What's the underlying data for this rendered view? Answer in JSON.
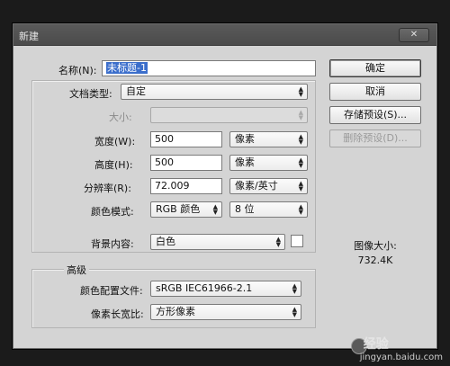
{
  "window": {
    "title": "新建",
    "close_icon": "✕"
  },
  "form": {
    "name_label": "名称(N):",
    "name_value": "未标题-1",
    "doc_type_label": "文档类型:",
    "doc_type_value": "自定",
    "size_label": "大小:",
    "size_value": "",
    "width_label": "宽度(W):",
    "width_value": "500",
    "width_unit": "像素",
    "height_label": "高度(H):",
    "height_value": "500",
    "height_unit": "像素",
    "resolution_label": "分辨率(R):",
    "resolution_value": "72.009",
    "resolution_unit": "像素/英寸",
    "color_mode_label": "颜色模式:",
    "color_mode_value": "RGB 颜色",
    "bit_depth_value": "8 位",
    "background_label": "背景内容:",
    "background_value": "白色",
    "background_swatch": "#ffffff"
  },
  "advanced": {
    "title": "高级",
    "profile_label": "颜色配置文件:",
    "profile_value": "sRGB IEC61966-2.1",
    "aspect_label": "像素长宽比:",
    "aspect_value": "方形像素"
  },
  "buttons": {
    "ok": "确定",
    "cancel": "取消",
    "save_preset": "存储预设(S)...",
    "delete_preset": "删除预设(D)..."
  },
  "image_size": {
    "label": "图像大小:",
    "value": "732.4K"
  },
  "watermark": {
    "brand": "经验",
    "url": "jingyan.baidu.com"
  },
  "colors": {
    "dialog_bg": "#d4d4d4",
    "title_bg": "#4f4f4f",
    "selection": "#3b6ecb"
  }
}
